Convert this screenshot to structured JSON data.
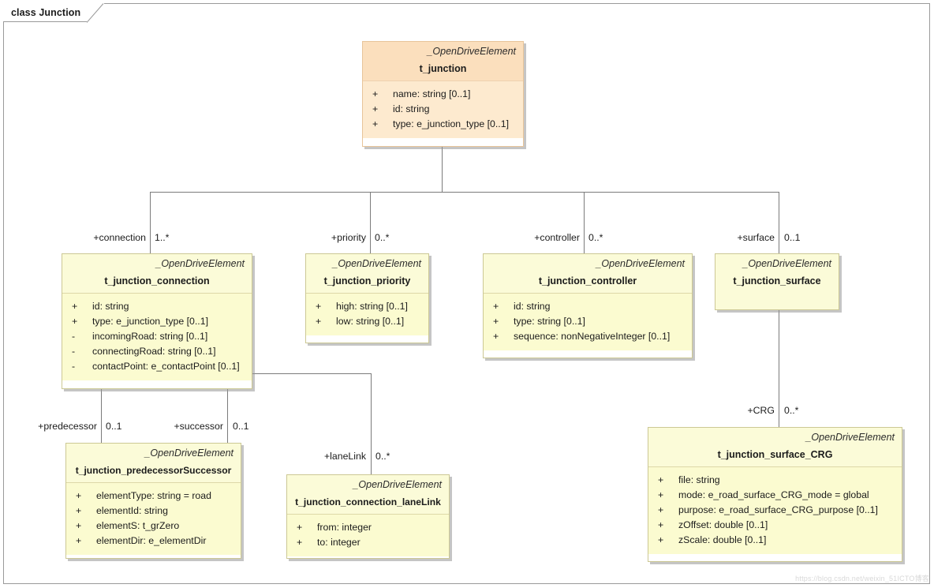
{
  "diagram": {
    "frame_title": "class Junction",
    "watermark": "https://blog.csdn.net/weixin_51ICTO博客"
  },
  "classes": {
    "junction": {
      "stereotype": "_OpenDriveElement",
      "name": "t_junction",
      "attributes": [
        {
          "visibility": "+",
          "text": "name: string [0..1]"
        },
        {
          "visibility": "+",
          "text": "id: string"
        },
        {
          "visibility": "+",
          "text": "type: e_junction_type [0..1]"
        }
      ]
    },
    "connection": {
      "stereotype": "_OpenDriveElement",
      "name": "t_junction_connection",
      "attributes": [
        {
          "visibility": "+",
          "text": "id: string"
        },
        {
          "visibility": "+",
          "text": "type: e_junction_type [0..1]"
        },
        {
          "visibility": "-",
          "text": "incomingRoad: string [0..1]"
        },
        {
          "visibility": "-",
          "text": "connectingRoad: string [0..1]"
        },
        {
          "visibility": "-",
          "text": "contactPoint: e_contactPoint [0..1]"
        }
      ]
    },
    "priority": {
      "stereotype": "_OpenDriveElement",
      "name": "t_junction_priority",
      "attributes": [
        {
          "visibility": "+",
          "text": "high: string [0..1]"
        },
        {
          "visibility": "+",
          "text": "low: string [0..1]"
        }
      ]
    },
    "controller": {
      "stereotype": "_OpenDriveElement",
      "name": "t_junction_controller",
      "attributes": [
        {
          "visibility": "+",
          "text": "id: string"
        },
        {
          "visibility": "+",
          "text": "type: string [0..1]"
        },
        {
          "visibility": "+",
          "text": "sequence: nonNegativeInteger [0..1]"
        }
      ]
    },
    "surface": {
      "stereotype": "_OpenDriveElement",
      "name": "t_junction_surface",
      "attributes": []
    },
    "predecessorSuccessor": {
      "stereotype": "_OpenDriveElement",
      "name": "t_junction_predecessorSuccessor",
      "attributes": [
        {
          "visibility": "+",
          "text": "elementType: string = road"
        },
        {
          "visibility": "+",
          "text": "elementId: string"
        },
        {
          "visibility": "+",
          "text": "elementS: t_grZero"
        },
        {
          "visibility": "+",
          "text": "elementDir: e_elementDir"
        }
      ]
    },
    "laneLink": {
      "stereotype": "_OpenDriveElement",
      "name": "t_junction_connection_laneLink",
      "attributes": [
        {
          "visibility": "+",
          "text": "from: integer"
        },
        {
          "visibility": "+",
          "text": "to: integer"
        }
      ]
    },
    "surfaceCRG": {
      "stereotype": "_OpenDriveElement",
      "name": "t_junction_surface_CRG",
      "attributes": [
        {
          "visibility": "+",
          "text": "file: string"
        },
        {
          "visibility": "+",
          "text": "mode: e_road_surface_CRG_mode = global"
        },
        {
          "visibility": "+",
          "text": "purpose: e_road_surface_CRG_purpose [0..1]"
        },
        {
          "visibility": "+",
          "text": "zOffset: double [0..1]"
        },
        {
          "visibility": "+",
          "text": "zScale: double [0..1]"
        }
      ]
    }
  },
  "associations": {
    "connection": {
      "role": "+connection",
      "multiplicity": "1..*"
    },
    "priority": {
      "role": "+priority",
      "multiplicity": "0..*"
    },
    "controller": {
      "role": "+controller",
      "multiplicity": "0..*"
    },
    "surface": {
      "role": "+surface",
      "multiplicity": "0..1"
    },
    "predecessor": {
      "role": "+predecessor",
      "multiplicity": "0..1"
    },
    "successor": {
      "role": "+successor",
      "multiplicity": "0..1"
    },
    "laneLink": {
      "role": "+laneLink",
      "multiplicity": "0..*"
    },
    "crg": {
      "role": "+CRG",
      "multiplicity": "0..*"
    }
  },
  "colors": {
    "root_header": "#fbdfbd",
    "root_body": "#fdeacf",
    "class_header": "#fbfbd8",
    "class_body": "#fbfbd0",
    "border": "#c8c49a",
    "connector": "#7b7b7b"
  }
}
